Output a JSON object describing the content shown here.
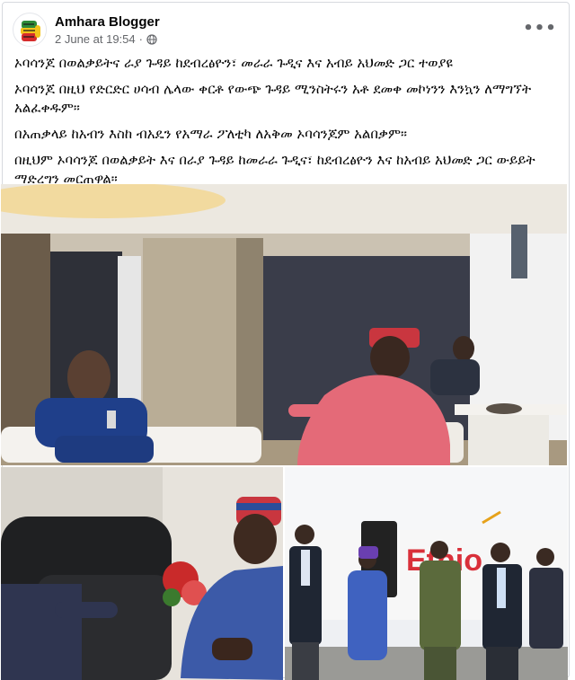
{
  "post": {
    "author": "Amhara Blogger",
    "timestamp": "2 June at 19:54",
    "privacy_icon": "globe-icon",
    "menu_icon": "more-options-icon",
    "paragraphs": [
      "ኦባሳንጆ በወልቃይትና ራያ ጉዳይ ከደብረፅዮን፣ መራራ ጉዲና እና አብይ አህመድ ጋር ተወያዩ",
      "ኦባሳንጆ በዚህ የድርድር ሀሳብ ሌላው ቀርቶ የውጭ ጉዳይ ሚንስትሩን አቶ ደመቀ መኮነንን እንኳን ለማግኘት አልፈቀዱም።",
      "በአጠቃላይ ከአብን እስከ ብአዴን የአማራ ፖለቲካ ለአቅመ ኦባሳንጆም አልበቃም።",
      "በዚህም ኦባሳንጆ በወልቃይት እና በራያ ጉዳይ ከመራራ ጉዲና፣ ከደብረፅዮን እና ከአብይ አህመድ ጋር ውይይት ማድረግን መርጠዋል።"
    ]
  },
  "photos": {
    "photo_3_sign_text": "Ethio"
  },
  "colors": {
    "author_text": "#050505",
    "meta_text": "#65676b",
    "border": "#d7dadf"
  }
}
